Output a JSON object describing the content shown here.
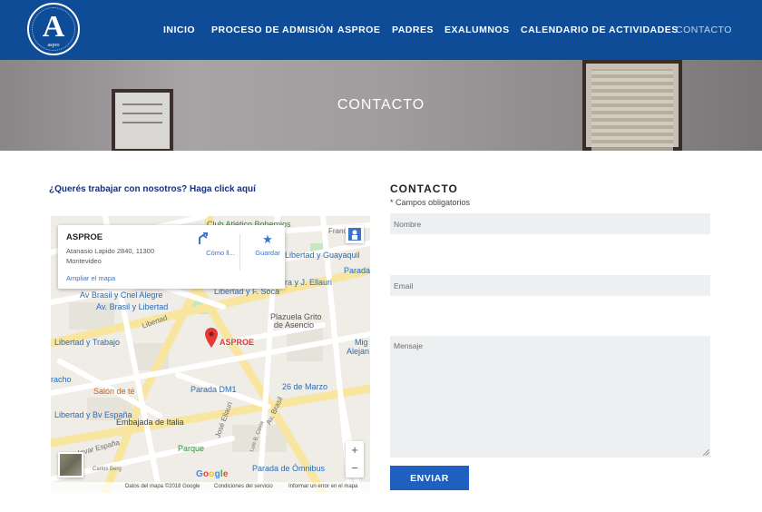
{
  "logo": {
    "letter": "A",
    "ring_text": "MONTE VI GUERRIS · LOS PILARES",
    "sub": "aspro"
  },
  "nav": {
    "items": [
      {
        "label": "INICIO"
      },
      {
        "label": "PROCESO DE ADMISIÓN"
      },
      {
        "label": "ASPROE"
      },
      {
        "label": "PADRES"
      },
      {
        "label": "EXALUMNOS"
      },
      {
        "label": "CALENDARIO DE ACTIVIDADES"
      },
      {
        "label": "CONTACTO"
      }
    ]
  },
  "banner": {
    "title": "CONTACTO"
  },
  "work_link": "¿Querés trabajar con nosotros? Haga click aquí",
  "map": {
    "card": {
      "name": "ASPROE",
      "address": "Atanasio Lapido 2840, 11300 Montevideo",
      "enlarge": "Ampliar el mapa",
      "directions": "Cómo ll...",
      "save": "Guardar"
    },
    "pin_label": "ASPROE",
    "labels": {
      "club": "Club Atlético Bohemios",
      "francisco": "Francisc",
      "libertad_guayaquil": "Libertad y Guayaquil",
      "parada_right": "Parada",
      "brasil_alegre": "Av Brasil y Cnel Alegre",
      "brasil_libertad": "Av. Brasil y Libertad",
      "libertad_soca": "Libertad y F. Soca",
      "ellauri": "ra y J. Ellauri",
      "plazuela": "Plazuela Grito",
      "asencio": "de Asencio",
      "libertad_trabajo": "Libertad y Trabajo",
      "mig": "Mig",
      "alejan": "Alejan",
      "racho": "racho",
      "salon": "Salón de té",
      "parada_dm1": "Parada DM1",
      "marzo": "26 de Marzo",
      "espana": "Libertad y Bv España",
      "embajada": "Embajada de Italia",
      "parque": "Parque",
      "omnibus": "Parada de Ómnibus",
      "av_brasil": "Av. Brasil",
      "libertad": "Libertad",
      "bulevar": "Bulevar España",
      "carlos": "Carlos Berg",
      "jose": "José Ellauri",
      "luis": "Luis B. Cavia"
    },
    "google": "Google",
    "footer": {
      "data": "Datos del mapa ©2018 Google",
      "terms": "Condiciones del servicio",
      "report": "Informar un error en el mapa"
    },
    "zoom_in": "+",
    "zoom_out": "−"
  },
  "form": {
    "title": "CONTACTO",
    "required_note": "* Campos obligatorios",
    "name_placeholder": "Nombre",
    "email_placeholder": "Email",
    "message_placeholder": "Mensaje",
    "submit_label": "ENVIAR"
  },
  "colors": {
    "header_bg": "#0f4c97",
    "link": "#1a2f7a",
    "button": "#1f5fbf",
    "field_bg": "#eeeff0",
    "pin": "#e53935"
  }
}
